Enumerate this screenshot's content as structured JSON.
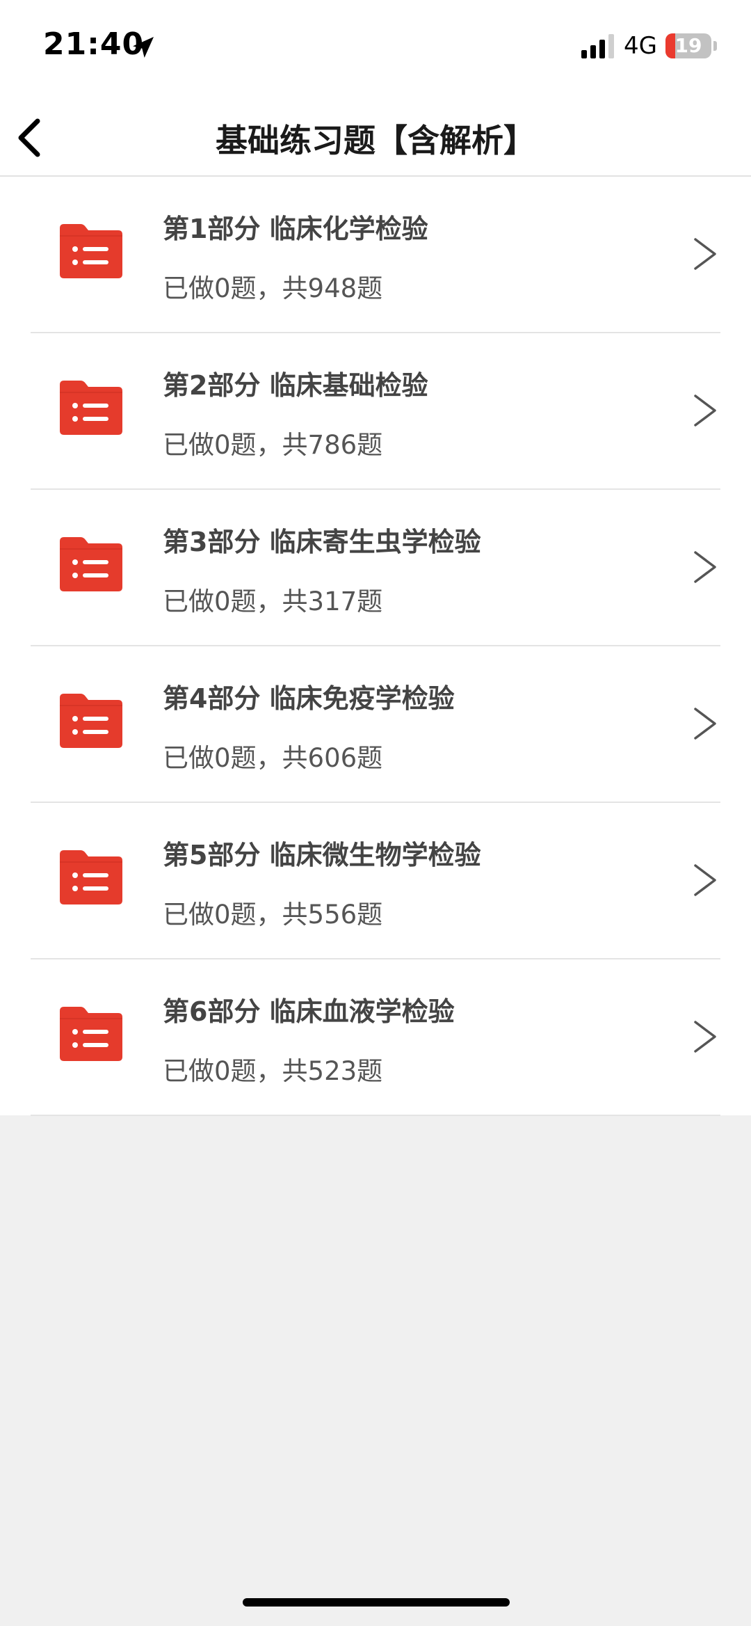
{
  "status_bar": {
    "time": "21:40",
    "network": "4G",
    "battery": "19",
    "icons": [
      "location-arrow-icon",
      "cellular-signal-icon",
      "battery-icon"
    ]
  },
  "nav": {
    "title": "基础练习题【含解析】",
    "back_icon": "chevron-left-icon"
  },
  "colors": {
    "accent": "#e53b2c",
    "page_background": "#f0f0f0",
    "list_background": "#ffffff",
    "divider": "#e4e4e4"
  },
  "sections": [
    {
      "title": "第1部分  临床化学检验",
      "progress": "已做0题，共948题",
      "icon": "folder-list-icon",
      "chevron": "chevron-right-icon"
    },
    {
      "title": "第2部分  临床基础检验",
      "progress": "已做0题，共786题",
      "icon": "folder-list-icon",
      "chevron": "chevron-right-icon"
    },
    {
      "title": "第3部分  临床寄生虫学检验",
      "progress": "已做0题，共317题",
      "icon": "folder-list-icon",
      "chevron": "chevron-right-icon"
    },
    {
      "title": "第4部分  临床免疫学检验",
      "progress": "已做0题，共606题",
      "icon": "folder-list-icon",
      "chevron": "chevron-right-icon"
    },
    {
      "title": "第5部分  临床微生物学检验",
      "progress": "已做0题，共556题",
      "icon": "folder-list-icon",
      "chevron": "chevron-right-icon"
    },
    {
      "title": "第6部分  临床血液学检验",
      "progress": "已做0题，共523题",
      "icon": "folder-list-icon",
      "chevron": "chevron-right-icon"
    }
  ]
}
